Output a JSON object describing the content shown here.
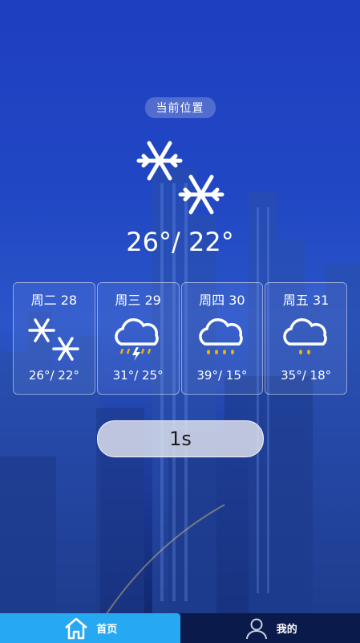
{
  "location": {
    "label": "当前位置"
  },
  "current": {
    "temp_range": "26°/ 22°",
    "icon": "snow-icon"
  },
  "forecast": [
    {
      "label": "周二 28",
      "temps": "26°/ 22°",
      "icon": "snow-icon"
    },
    {
      "label": "周三 29",
      "temps": "31°/ 25°",
      "icon": "thunder-rain-icon"
    },
    {
      "label": "周四 30",
      "temps": "39°/ 15°",
      "icon": "rain-icon"
    },
    {
      "label": "周五 31",
      "temps": "35°/ 18°",
      "icon": "light-rain-icon"
    }
  ],
  "timer": {
    "label": "1s"
  },
  "nav": {
    "home_label": "首页",
    "mine_label": "我的"
  },
  "colors": {
    "background": "#2147c4",
    "nav_active": "#27a9f2",
    "nav_bg": "#0a1a4a"
  }
}
